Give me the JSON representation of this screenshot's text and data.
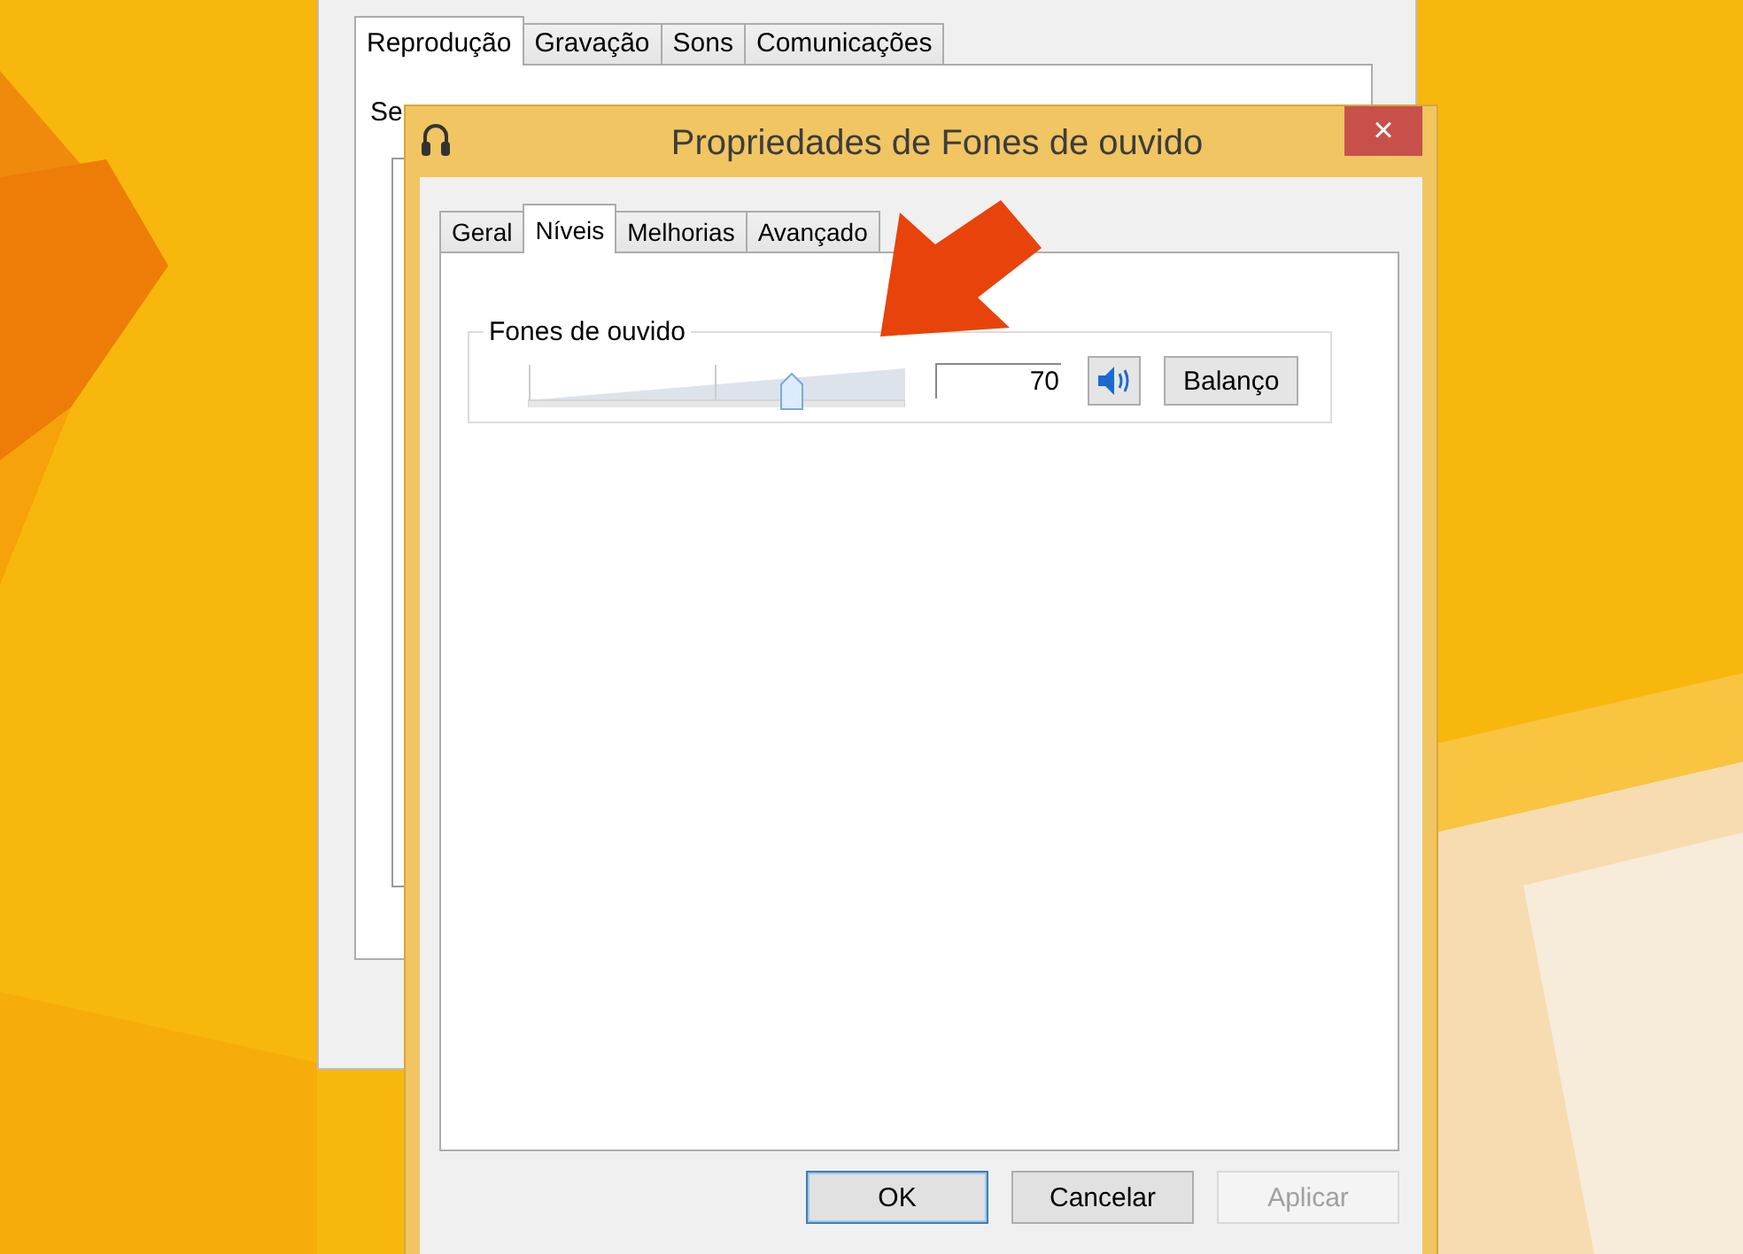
{
  "back_window": {
    "tabs": [
      {
        "label": "Reprodução",
        "selected": true
      },
      {
        "label": "Gravação",
        "selected": false
      },
      {
        "label": "Sons",
        "selected": false
      },
      {
        "label": "Comunicações",
        "selected": false
      }
    ],
    "text": "Se"
  },
  "dialog": {
    "title": "Propriedades de Fones de ouvido",
    "close": "×",
    "tabs": [
      {
        "label": "Geral",
        "selected": false
      },
      {
        "label": "Níveis",
        "selected": true
      },
      {
        "label": "Melhorias",
        "selected": false
      },
      {
        "label": "Avançado",
        "selected": false
      }
    ],
    "group": {
      "label": "Fones de ouvido",
      "level": 0.7,
      "value": "70",
      "muted": false,
      "balance_button": "Balanço"
    },
    "buttons": [
      {
        "label": "OK",
        "kind": "default",
        "disabled": false
      },
      {
        "label": "Cancelar",
        "kind": "normal",
        "disabled": false
      },
      {
        "label": "Aplicar",
        "kind": "normal",
        "disabled": true
      }
    ]
  }
}
